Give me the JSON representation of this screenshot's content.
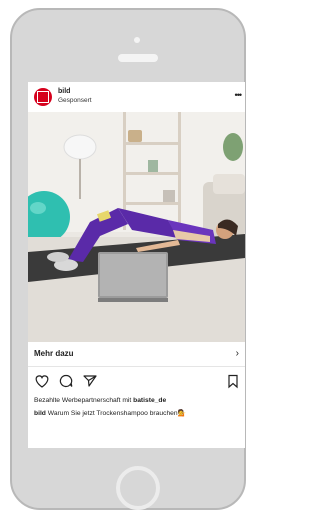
{
  "post": {
    "account_name": "bild",
    "sponsored_label": "Gesponsert",
    "more_icon": "more-horizontal-icon",
    "cta_label": "Mehr dazu",
    "cta_chevron": "›",
    "caption": {
      "partner_prefix": "Bezahlte Werbepartnerschaft mit ",
      "partner_account": "batiste_de",
      "caption_account": "bild",
      "caption_text": "Warum Sie jetzt Trockenshampoo brauchen",
      "emoji": "💁"
    }
  },
  "icons": {
    "like": "heart-icon",
    "comment": "comment-icon",
    "share": "send-icon",
    "save": "bookmark-icon"
  },
  "colors": {
    "brand_red": "#d6001c",
    "phone_body": "#d7d7d7",
    "outfit_purple": "#5a2aa8",
    "ball_teal": "#2fbfb0"
  }
}
